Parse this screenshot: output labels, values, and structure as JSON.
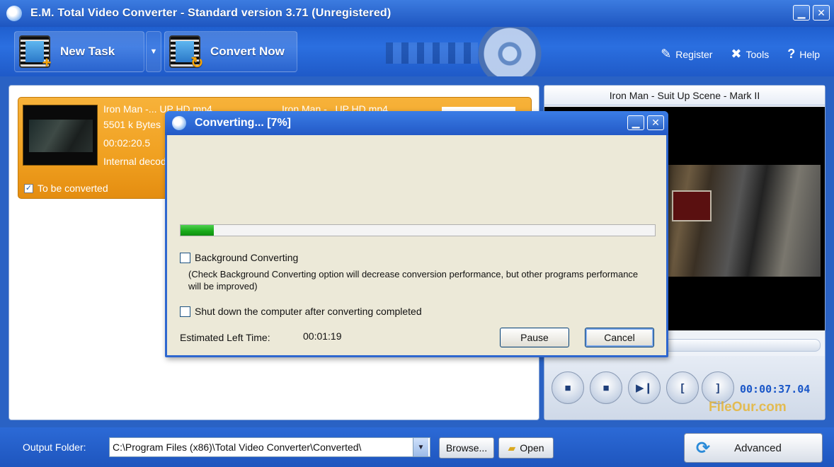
{
  "window": {
    "title": "E.M. Total Video Converter - Standard version 3.71 (Unregistered)",
    "minimize_symbol": "▁",
    "close_symbol": "✕"
  },
  "toolbar": {
    "new_task_label": "New Task",
    "convert_now_label": "Convert Now",
    "register_label": "Register",
    "tools_label": "Tools",
    "help_label": "Help",
    "icons": [
      "new-task-icon",
      "convert-now-icon",
      "register-icon",
      "tools-icon",
      "help-icon"
    ]
  },
  "task": {
    "name": "Iron Man -... UP HD.mp4",
    "output_name": "Iron Man -...UP HD.mp4",
    "size": "5501 k Bytes",
    "duration": "00:02:20.5",
    "decoder": "Internal decod",
    "to_be_converted_label": "To be converted",
    "to_be_converted_checked": true
  },
  "dialog": {
    "title": "Converting... [7%]",
    "progress_percent": 7,
    "background_label": "Background Converting",
    "background_note": "(Check Background Converting option will decrease conversion performance, but other programs performance will be improved)",
    "shutdown_label": "Shut down the computer after converting completed",
    "estimated_label": "Estimated Left Time:",
    "estimated_value": "00:01:19",
    "pause_label": "Pause",
    "cancel_label": "Cancel"
  },
  "preview": {
    "title": "Iron Man - Suit Up Scene - Mark II",
    "time": "00:00:37.04",
    "watermark": "FileOur.com",
    "controls": [
      "stop-icon",
      "stop-icon",
      "play-pause-icon",
      "mark-in-icon",
      "mark-out-icon"
    ]
  },
  "bottom": {
    "output_folder_label": "Output Folder:",
    "output_folder_value": "C:\\Program Files (x86)\\Total Video Converter\\Converted\\",
    "browse_label": "Browse...",
    "open_label": "Open",
    "advanced_label": "Advanced"
  },
  "colors": {
    "accent_blue": "#2a62c4",
    "task_orange": "#f0a020",
    "progress_green": "#18a818",
    "time_blue": "#1a57c8"
  }
}
